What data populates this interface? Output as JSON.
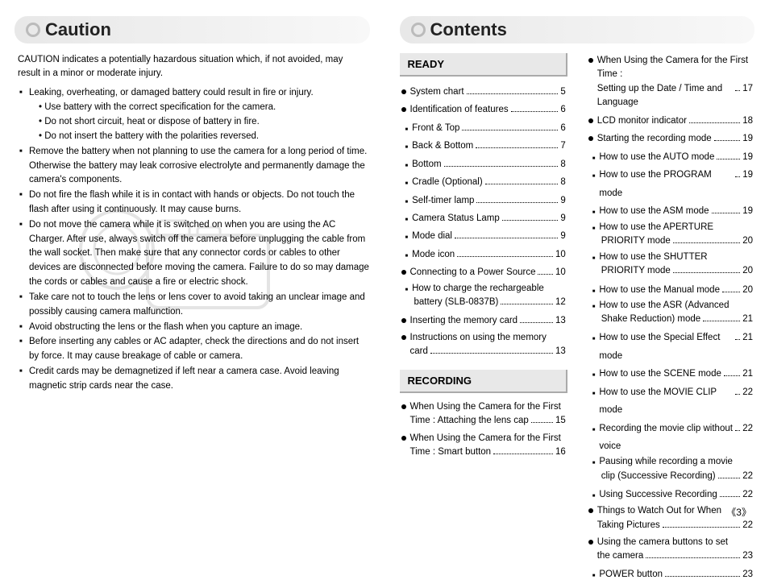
{
  "left": {
    "title": "Caution",
    "intro": "CAUTION indicates a potentially hazardous situation which, if not avoided, may result in a minor or moderate injury.",
    "items": [
      {
        "text": "Leaking, overheating, or damaged battery could result in fire or injury.",
        "sub": [
          "• Use battery with the correct specification for the camera.",
          "• Do not short circuit, heat or dispose of battery in fire.",
          "• Do not insert the battery with the polarities reversed."
        ]
      },
      {
        "text": "Remove the battery when not planning to use the camera for a long period of time. Otherwise the battery may leak corrosive electrolyte and permanently damage the camera's components."
      },
      {
        "text": "Do not fire the flash while it is in contact with hands or objects. Do not touch the flash after using it continuously. It may cause burns."
      },
      {
        "text": "Do not move the camera while it is switched on when you are using the AC Charger. After use, always switch off the camera before unplugging the cable from the wall socket. Then make sure that any connector cords or cables to other devices are disconnected before moving the camera. Failure to do so may damage the cords or cables and cause a fire or electric shock."
      },
      {
        "text": "Take care not to touch the lens or lens cover to avoid taking an unclear image and possibly causing camera malfunction."
      },
      {
        "text": "Avoid obstructing the lens or the flash when you capture an image."
      },
      {
        "text": "Before inserting any cables or AC adapter, check the directions and do not insert by force. It may cause breakage of cable or camera."
      },
      {
        "text": "Credit cards may be demagnetized if left near a camera case. Avoid leaving magnetic strip cards near the case."
      }
    ]
  },
  "right": {
    "title": "Contents",
    "sections": [
      {
        "heading": "READY",
        "items": [
          {
            "bullet": "circle",
            "label": "System chart",
            "page": "5"
          },
          {
            "bullet": "circle",
            "label": "Identification of features",
            "page": "6"
          },
          {
            "bullet": "sq",
            "label": "Front & Top",
            "page": "6"
          },
          {
            "bullet": "sq",
            "label": "Back & Bottom",
            "page": "7"
          },
          {
            "bullet": "sq",
            "label": "Bottom",
            "page": "8"
          },
          {
            "bullet": "sq",
            "label": "Cradle (Optional)",
            "page": "8"
          },
          {
            "bullet": "sq",
            "label": "Self-timer lamp",
            "page": "9"
          },
          {
            "bullet": "sq",
            "label": "Camera Status Lamp",
            "page": "9"
          },
          {
            "bullet": "sq",
            "label": "Mode dial",
            "page": "9"
          },
          {
            "bullet": "sq",
            "label": "Mode icon",
            "page": "10"
          },
          {
            "bullet": "circle",
            "label": "Connecting to a Power Source",
            "page": "10"
          },
          {
            "bullet": "sq",
            "wrap": true,
            "line1": "How to charge the rechargeable",
            "line2": "battery (SLB-0837B)",
            "page": "12"
          },
          {
            "bullet": "circle",
            "label": "Inserting the memory card",
            "page": "13"
          },
          {
            "bullet": "circle",
            "wrap": true,
            "line1": "Instructions on using the memory",
            "line2": "card",
            "page": "13"
          }
        ]
      },
      {
        "heading": "RECORDING",
        "items": [
          {
            "bullet": "circle",
            "wrap": true,
            "line1": "When Using the Camera for the First",
            "line2": "Time : Attaching the lens cap",
            "page": "15"
          },
          {
            "bullet": "circle",
            "wrap": true,
            "line1": "When Using the Camera for the First",
            "line2": "Time : Smart button",
            "page": "16"
          }
        ]
      }
    ],
    "col2": [
      {
        "bullet": "circle",
        "wrap": true,
        "line1": "When Using the Camera for the First Time :",
        "line2": "Setting up the Date / Time and Language",
        "page": "17"
      },
      {
        "bullet": "circle",
        "label": "LCD monitor indicator",
        "page": "18"
      },
      {
        "bullet": "circle",
        "label": "Starting the recording mode",
        "page": "19"
      },
      {
        "bullet": "sq",
        "label": "How to use the AUTO mode",
        "page": "19"
      },
      {
        "bullet": "sq",
        "label": "How to use the PROGRAM mode",
        "page": "19"
      },
      {
        "bullet": "sq",
        "label": "How to use the ASM mode",
        "page": "19"
      },
      {
        "bullet": "sq",
        "wrap": true,
        "line1": "How to use the APERTURE",
        "line2": "PRIORITY mode",
        "page": "20"
      },
      {
        "bullet": "sq",
        "wrap": true,
        "line1": "How to use the SHUTTER",
        "line2": "PRIORITY mode",
        "page": "20"
      },
      {
        "bullet": "sq",
        "label": "How to use the Manual mode",
        "page": "20"
      },
      {
        "bullet": "sq",
        "wrap": true,
        "line1": "How to use the ASR (Advanced",
        "line2": "Shake Reduction) mode",
        "page": "21"
      },
      {
        "bullet": "sq",
        "label": "How to use the Special Effect mode",
        "page": "21"
      },
      {
        "bullet": "sq",
        "label": "How to use the SCENE mode",
        "page": "21"
      },
      {
        "bullet": "sq",
        "label": "How to use the MOVIE CLIP mode",
        "page": "22"
      },
      {
        "bullet": "sq",
        "label": "Recording the movie clip without voice",
        "page": "22"
      },
      {
        "bullet": "sq",
        "wrap": true,
        "line1": "Pausing while recording a movie",
        "line2": "clip (Successive Recording)",
        "page": "22"
      },
      {
        "bullet": "sq",
        "label": "Using Successive Recording",
        "page": "22"
      },
      {
        "bullet": "circle",
        "wrap": true,
        "line1": "Things to Watch Out for When",
        "line2": "Taking Pictures",
        "page": "22"
      },
      {
        "bullet": "circle",
        "wrap": true,
        "line1": "Using the camera buttons to set",
        "line2": "the camera",
        "page": "23"
      },
      {
        "bullet": "sq",
        "label": "POWER button",
        "page": "23"
      }
    ]
  },
  "footer_page": "3"
}
